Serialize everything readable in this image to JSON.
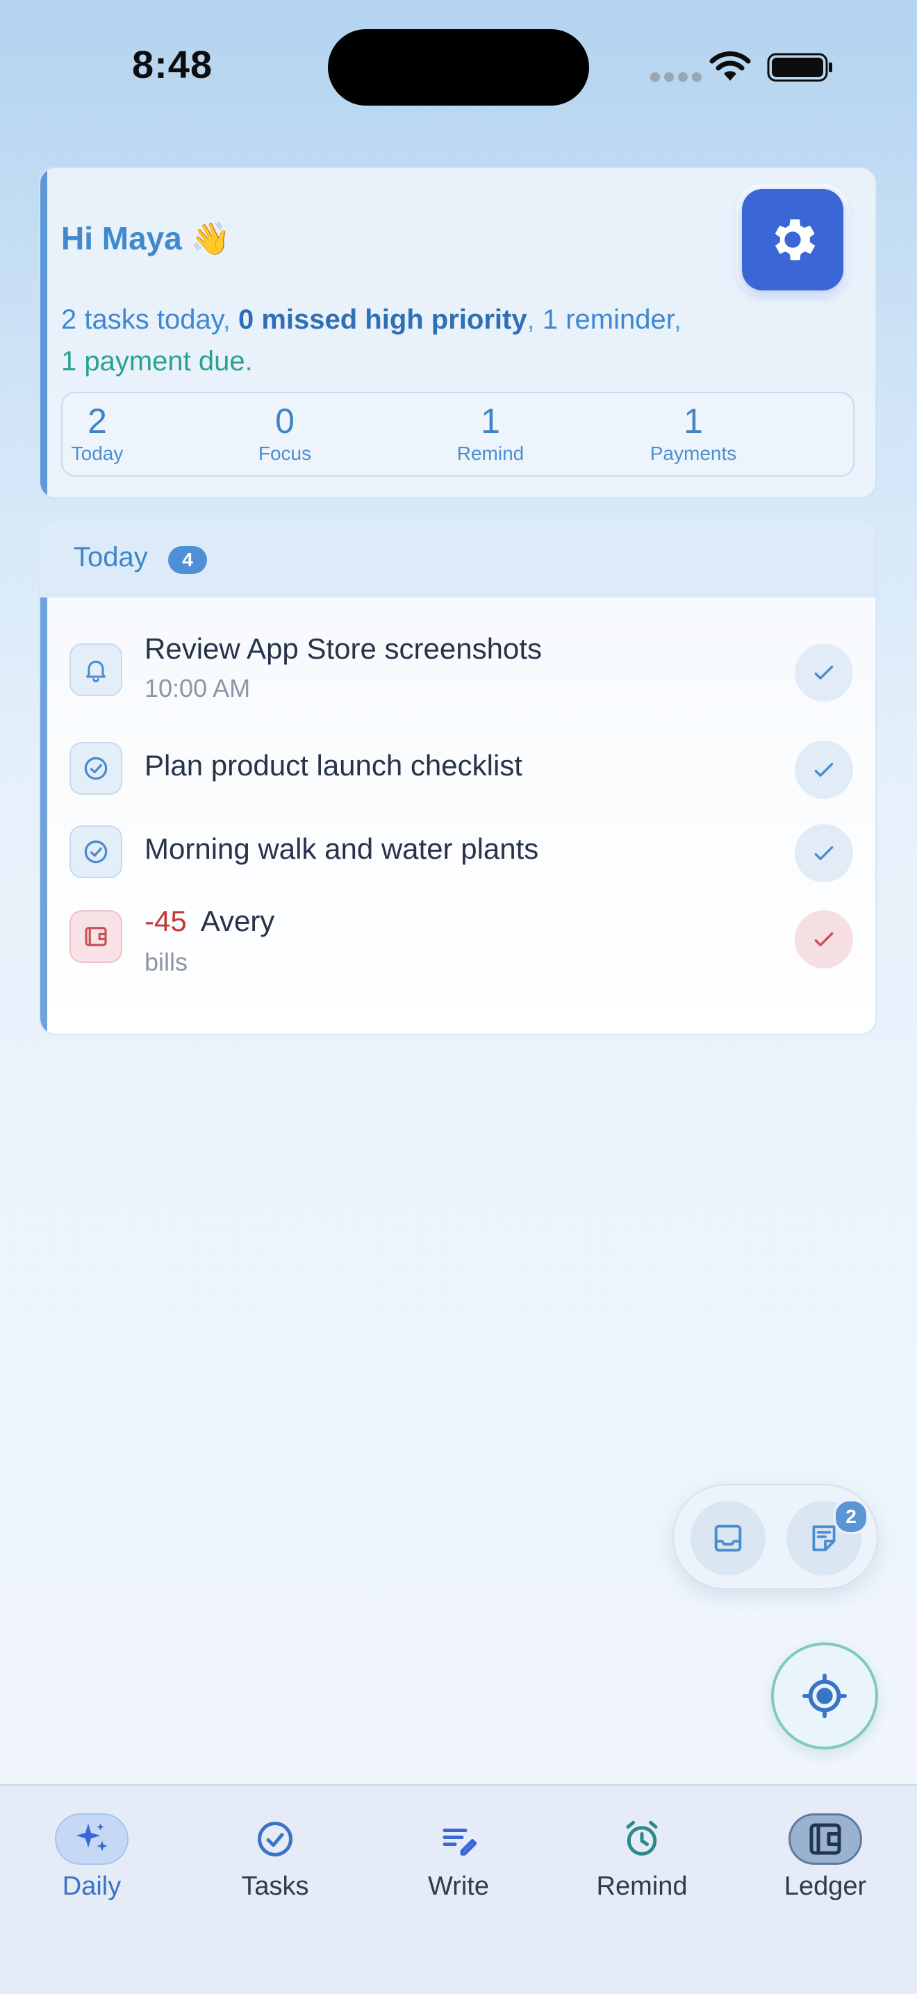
{
  "status": {
    "time": "8:48"
  },
  "header": {
    "greeting": "Hi Maya 👋",
    "summary": {
      "tasks": "2 tasks today",
      "sep1": ", ",
      "missed": "0 missed high priority",
      "sep2": ", ",
      "reminder": "1 reminder",
      "sep3": ",",
      "payment": "1 payment due."
    },
    "stats": [
      {
        "value": "2",
        "label": "Today"
      },
      {
        "value": "0",
        "label": "Focus"
      },
      {
        "value": "1",
        "label": "Remind"
      },
      {
        "value": "1",
        "label": "Payments"
      }
    ]
  },
  "today": {
    "title": "Today",
    "count": "4",
    "items": [
      {
        "icon": "bell-icon",
        "title": "Review App Store screenshots",
        "subtitle": "10:00 AM"
      },
      {
        "icon": "check-circle-icon",
        "title": "Plan product launch checklist"
      },
      {
        "icon": "check-circle-icon",
        "title": "Morning walk and water plants"
      },
      {
        "icon": "wallet-icon",
        "amount": "-45",
        "title": "Avery",
        "subtitle": "bills"
      }
    ]
  },
  "floating": {
    "notes_badge": "2"
  },
  "tabs": [
    {
      "label": "Daily",
      "icon": "sparkles-icon"
    },
    {
      "label": "Tasks",
      "icon": "check-circle-icon"
    },
    {
      "label": "Write",
      "icon": "pen-lines-icon"
    },
    {
      "label": "Remind",
      "icon": "alarm-clock-icon"
    },
    {
      "label": "Ledger",
      "icon": "wallet-icon"
    }
  ],
  "colors": {
    "accent": "#3a66d6",
    "primary_text": "#263349",
    "money_negative": "#c03a3a",
    "payment_green": "#2aa38e"
  }
}
